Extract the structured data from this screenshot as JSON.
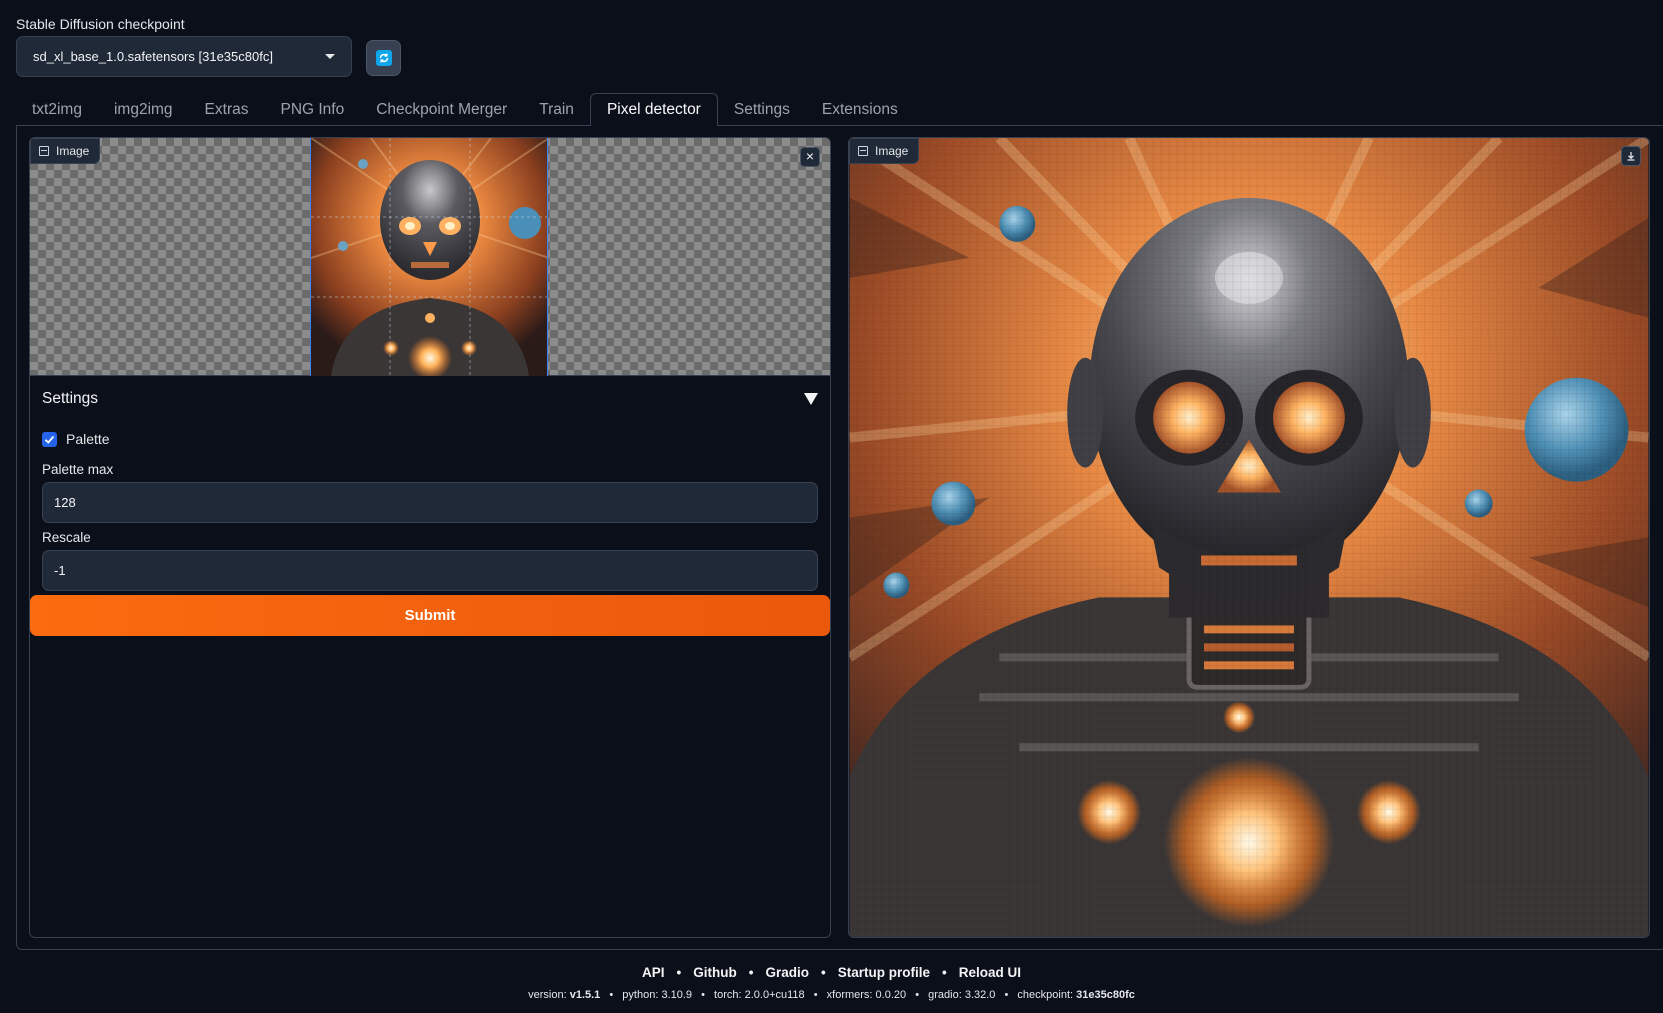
{
  "checkpoint": {
    "label": "Stable Diffusion checkpoint",
    "selected": "sd_xl_base_1.0.safetensors [31e35c80fc]",
    "refresh_icon": "refresh-icon"
  },
  "tabs": [
    {
      "label": "txt2img"
    },
    {
      "label": "img2img"
    },
    {
      "label": "Extras"
    },
    {
      "label": "PNG Info"
    },
    {
      "label": "Checkpoint Merger"
    },
    {
      "label": "Train"
    },
    {
      "label": "Pixel detector",
      "active": true
    },
    {
      "label": "Settings"
    },
    {
      "label": "Extensions"
    }
  ],
  "input_image": {
    "label": "Image",
    "icon": "image-icon",
    "clear_icon": "close-icon",
    "clear_glyph": "×"
  },
  "settings": {
    "title": "Settings",
    "palette_label": "Palette",
    "palette_checked": true,
    "palette_max_label": "Palette max",
    "palette_max_value": "128",
    "rescale_label": "Rescale",
    "rescale_value": "-1"
  },
  "submit_label": "Submit",
  "output_image": {
    "label": "Image",
    "icon": "image-icon",
    "download_icon": "download-icon"
  },
  "footer": {
    "links": [
      "API",
      "Github",
      "Gradio",
      "Startup profile",
      "Reload UI"
    ],
    "separator": "•",
    "versions": {
      "version_label": "version:",
      "version": "v1.5.1",
      "python_label": "python:",
      "python": "3.10.9",
      "torch_label": "torch:",
      "torch": "2.0.0+cu118",
      "xformers_label": "xformers:",
      "xformers": "0.0.20",
      "gradio_label": "gradio:",
      "gradio": "3.32.0",
      "checkpoint_label": "checkpoint:",
      "checkpoint": "31e35c80fc"
    }
  },
  "colors": {
    "background": "#0b0f19",
    "accent": "#f97316",
    "checkbox": "#2563eb",
    "refresh": "#0ea5e9"
  }
}
